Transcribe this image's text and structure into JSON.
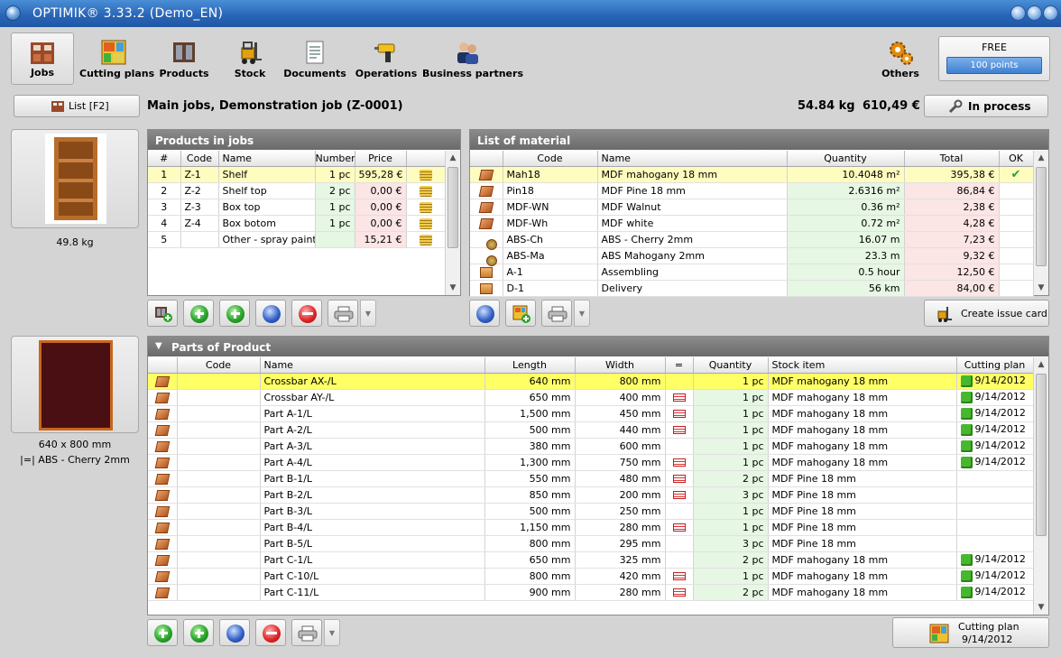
{
  "window": {
    "title": "OPTIMIK® 3.33.2  (Demo_EN)"
  },
  "toolbar": {
    "items": [
      {
        "label": "Jobs",
        "icon": "jobs-icon"
      },
      {
        "label": "Cutting plans",
        "icon": "cutting-plans-icon"
      },
      {
        "label": "Products",
        "icon": "products-icon"
      },
      {
        "label": "Stock",
        "icon": "forklift-icon"
      },
      {
        "label": "Documents",
        "icon": "documents-icon"
      },
      {
        "label": "Operations",
        "icon": "drill-icon"
      },
      {
        "label": "Business partners",
        "icon": "business-partners-icon"
      },
      {
        "label": "Others",
        "icon": "gears-icon"
      }
    ],
    "license": {
      "label": "FREE",
      "points": "100 points"
    }
  },
  "infobar": {
    "list_button": "List [F2]",
    "job_title": "Main jobs, Demonstration job  (Z-0001)",
    "weight": "54.84 kg",
    "total": "610,49 €",
    "status_button": "In process"
  },
  "product_preview": {
    "caption": "49.8 kg"
  },
  "part_preview": {
    "size": "640 x 800 mm",
    "edge": "|=|  ABS - Cherry 2mm"
  },
  "products_panel": {
    "title": "Products in jobs",
    "columns": [
      "#",
      "Code",
      "Name",
      "Number",
      "Price",
      ""
    ],
    "rows": [
      {
        "n": "1",
        "code": "Z-1",
        "name": "Shelf",
        "number": "1 pc",
        "price": "595,28 €"
      },
      {
        "n": "2",
        "code": "Z-2",
        "name": "Shelf top",
        "number": "2 pc",
        "price": "0,00 €"
      },
      {
        "n": "3",
        "code": "Z-3",
        "name": "Box top",
        "number": "1 pc",
        "price": "0,00 €"
      },
      {
        "n": "4",
        "code": "Z-4",
        "name": "Box botom",
        "number": "1 pc",
        "price": "0,00 €"
      },
      {
        "n": "5",
        "code": "",
        "name": "Other - spray paint...",
        "number": "",
        "price": "15,21 €"
      }
    ]
  },
  "material_panel": {
    "title": "List of material",
    "columns": [
      "",
      "Code",
      "Name",
      "Quantity",
      "Total",
      "OK"
    ],
    "rows": [
      {
        "code": "Mah18",
        "name": "MDF mahogany 18 mm",
        "qty": "10.4048 m²",
        "total": "395,38 €",
        "ok": "✔",
        "icon": "board-icon"
      },
      {
        "code": "Pin18",
        "name": "MDF Pine 18 mm",
        "qty": "2.6316 m²",
        "total": "86,84 €",
        "ok": "",
        "icon": "board-icon"
      },
      {
        "code": "MDF-WN",
        "name": "MDF Walnut",
        "qty": "0.36 m²",
        "total": "2,38 €",
        "ok": "",
        "icon": "board-icon"
      },
      {
        "code": "MDF-Wh",
        "name": "MDF white",
        "qty": "0.72 m²",
        "total": "4,28 €",
        "ok": "",
        "icon": "board-icon"
      },
      {
        "code": "ABS-Ch",
        "name": "ABS - Cherry 2mm",
        "qty": "16.07 m",
        "total": "7,23 €",
        "ok": "",
        "icon": "edge-roll-icon"
      },
      {
        "code": "ABS-Ma",
        "name": "ABS Mahogany 2mm",
        "qty": "23.3 m",
        "total": "9,32 €",
        "ok": "",
        "icon": "edge-roll-icon"
      },
      {
        "code": "A-1",
        "name": "Assembling",
        "qty": "0.5 hour",
        "total": "12,50 €",
        "ok": "",
        "icon": "service-box-icon"
      },
      {
        "code": "D-1",
        "name": "Delivery",
        "qty": "56 km",
        "total": "84,00 €",
        "ok": "",
        "icon": "service-box-icon"
      }
    ],
    "create_issue_card": "Create issue card"
  },
  "parts_panel": {
    "title": "Parts of Product",
    "columns": [
      "",
      "Code",
      "Name",
      "Length",
      "Width",
      "=",
      "Quantity",
      "Stock item",
      "Cutting plan"
    ],
    "rows": [
      {
        "name": "Crossbar AX-/L",
        "length": "640 mm",
        "width": "800 mm",
        "edge": false,
        "qty": "1 pc",
        "stock": "MDF mahogany 18 mm",
        "plan": "9/14/2012"
      },
      {
        "name": "Crossbar AY-/L",
        "length": "650 mm",
        "width": "400 mm",
        "edge": true,
        "qty": "1 pc",
        "stock": "MDF mahogany 18 mm",
        "plan": "9/14/2012"
      },
      {
        "name": "Part A-1/L",
        "length": "1,500 mm",
        "width": "450 mm",
        "edge": true,
        "qty": "1 pc",
        "stock": "MDF mahogany 18 mm",
        "plan": "9/14/2012"
      },
      {
        "name": "Part A-2/L",
        "length": "500 mm",
        "width": "440 mm",
        "edge": true,
        "qty": "1 pc",
        "stock": "MDF mahogany 18 mm",
        "plan": "9/14/2012"
      },
      {
        "name": "Part A-3/L",
        "length": "380 mm",
        "width": "600 mm",
        "edge": false,
        "qty": "1 pc",
        "stock": "MDF mahogany 18 mm",
        "plan": "9/14/2012"
      },
      {
        "name": "Part A-4/L",
        "length": "1,300 mm",
        "width": "750 mm",
        "edge": true,
        "qty": "1 pc",
        "stock": "MDF mahogany 18 mm",
        "plan": "9/14/2012"
      },
      {
        "name": "Part B-1/L",
        "length": "550 mm",
        "width": "480 mm",
        "edge": true,
        "qty": "2 pc",
        "stock": "MDF Pine 18 mm",
        "plan": ""
      },
      {
        "name": "Part B-2/L",
        "length": "850 mm",
        "width": "200 mm",
        "edge": true,
        "qty": "3 pc",
        "stock": "MDF Pine 18 mm",
        "plan": ""
      },
      {
        "name": "Part B-3/L",
        "length": "500 mm",
        "width": "250 mm",
        "edge": false,
        "qty": "1 pc",
        "stock": "MDF Pine 18 mm",
        "plan": ""
      },
      {
        "name": "Part B-4/L",
        "length": "1,150 mm",
        "width": "280 mm",
        "edge": true,
        "qty": "1 pc",
        "stock": "MDF Pine 18 mm",
        "plan": ""
      },
      {
        "name": "Part B-5/L",
        "length": "800 mm",
        "width": "295 mm",
        "edge": false,
        "qty": "3 pc",
        "stock": "MDF Pine 18 mm",
        "plan": ""
      },
      {
        "name": "Part C-1/L",
        "length": "650 mm",
        "width": "325 mm",
        "edge": false,
        "qty": "2 pc",
        "stock": "MDF mahogany 18 mm",
        "plan": "9/14/2012"
      },
      {
        "name": "Part C-10/L",
        "length": "800 mm",
        "width": "420 mm",
        "edge": true,
        "qty": "1 pc",
        "stock": "MDF mahogany 18 mm",
        "plan": "9/14/2012"
      },
      {
        "name": "Part C-11/L",
        "length": "900 mm",
        "width": "280 mm",
        "edge": true,
        "qty": "2 pc",
        "stock": "MDF mahogany 18 mm",
        "plan": "9/14/2012"
      }
    ],
    "cutting_plan_button": {
      "label": "Cutting plan",
      "date": "9/14/2012"
    }
  }
}
